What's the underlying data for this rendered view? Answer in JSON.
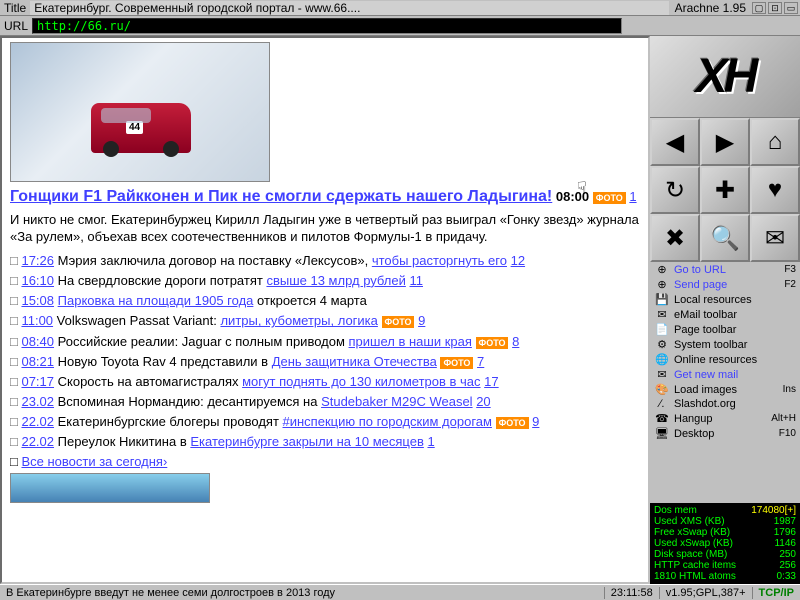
{
  "title_label": "Title",
  "title": "Екатеринбург. Современный городской портал - www.66....",
  "version": "Arachne 1.95",
  "url_label": "URL",
  "url": "http://66.ru/",
  "headline": "Гонщики F1 Райкконен и Пик не смогли сдержать нашего Ладыгина!",
  "headline_time": "08:00",
  "badge": "ФОТО",
  "headline_num": "1",
  "lead": "И никто не смог. Екатеринбуржец Кирилл Ладыгин уже в четвертый раз выиграл «Гонку звезд» журнала «За рулем», объехав всех соотечественников и пилотов Формулы-1 в придачу.",
  "news": [
    {
      "t": "17:26",
      "pre": "Мэрия заключила договор на поставку «Лексусов», ",
      "link": "чтобы расторгнуть его",
      "post": " ",
      "num": "12",
      "badge": false
    },
    {
      "t": "16:10",
      "pre": "На свердловские дороги потратят ",
      "link": "свыше 13 млрд рублей",
      "post": " ",
      "num": "11",
      "badge": false
    },
    {
      "t": "15:08",
      "pre": "",
      "link": "Парковка на площади 1905 года",
      "post": " откроется 4 марта",
      "num": "",
      "badge": false
    },
    {
      "t": "11:00",
      "pre": "Volkswagen Passat Variant: ",
      "link": "литры, кубометры, логика",
      "post": " ",
      "num": "9",
      "badge": true
    },
    {
      "t": "08:40",
      "pre": "Российские реалии: Jaguar с полным приводом ",
      "link": "пришел в наши края",
      "post": " ",
      "num": "8",
      "badge": true
    },
    {
      "t": "08:21",
      "pre": "Новую Toyota Rav 4 представили в ",
      "link": "День защитника Отечества",
      "post": " ",
      "num": "7",
      "badge": true
    },
    {
      "t": "07:17",
      "pre": "Скорость на автомагистралях ",
      "link": "могут поднять до 130 километров в час",
      "post": " ",
      "num": "17",
      "badge": false
    },
    {
      "t": "23.02",
      "pre": "Вспоминая Нормандию: десантируемся на ",
      "link": "Studebaker M29C Weasel",
      "post": " ",
      "num": "20",
      "badge": false
    },
    {
      "t": "22.02",
      "pre": "Екатеринбургские блогеры проводят ",
      "link": "#инспекцию по городским дорогам",
      "post": " ",
      "num": "9",
      "badge": true
    },
    {
      "t": "22.02",
      "pre": "Переулок Никитина в ",
      "link": "Екатеринбурге закрыли на 10 месяцев",
      "post": " ",
      "num": "1",
      "badge": false
    }
  ],
  "all_news": "Все новости за сегодня›",
  "nav_icons": [
    "◀",
    "▶",
    "⌂",
    "↻",
    "✚",
    "♥",
    "✖",
    "🔍",
    "✉"
  ],
  "menu": [
    {
      "ic": "⊕",
      "tx": "Go to URL",
      "sc": "F3",
      "hl": true
    },
    {
      "ic": "⊕",
      "tx": "Send page",
      "sc": "F2",
      "hl": true
    },
    {
      "ic": "💾",
      "tx": "Local resources",
      "sc": ""
    },
    {
      "ic": "✉",
      "tx": "eMail toolbar",
      "sc": ""
    },
    {
      "ic": "📄",
      "tx": "Page toolbar",
      "sc": ""
    },
    {
      "ic": "⚙",
      "tx": "System toolbar",
      "sc": ""
    },
    {
      "ic": "🌐",
      "tx": "Online resources",
      "sc": ""
    },
    {
      "ic": "✉",
      "tx": "Get new mail",
      "sc": "",
      "hl": true
    },
    {
      "ic": "🎨",
      "tx": "Load images",
      "sc": "Ins"
    },
    {
      "ic": "∕.",
      "tx": "Slashdot.org",
      "sc": ""
    },
    {
      "ic": "☎",
      "tx": "Hangup",
      "sc": "Alt+H"
    },
    {
      "ic": "🖥",
      "tx": "Desktop",
      "sc": "F10"
    }
  ],
  "stats": [
    {
      "k": "Dos mem",
      "v": "174080[+]",
      "y": true
    },
    {
      "k": "Used XMS (KB)",
      "v": "1987"
    },
    {
      "k": "Free xSwap (KB)",
      "v": "1796"
    },
    {
      "k": "Used xSwap (KB)",
      "v": "1146"
    },
    {
      "k": "Disk space (MB)",
      "v": "250"
    },
    {
      "k": "HTTP cache items",
      "v": "256"
    },
    {
      "k": "1810 HTML atoms",
      "v": "0:33"
    }
  ],
  "status_msg": "В Екатеринбурге введут не менее семи долгостроев в 2013 году",
  "status_clock": "23:11:58",
  "status_info": "v1.95;GPL,387+",
  "status_net": "TCP/IP"
}
